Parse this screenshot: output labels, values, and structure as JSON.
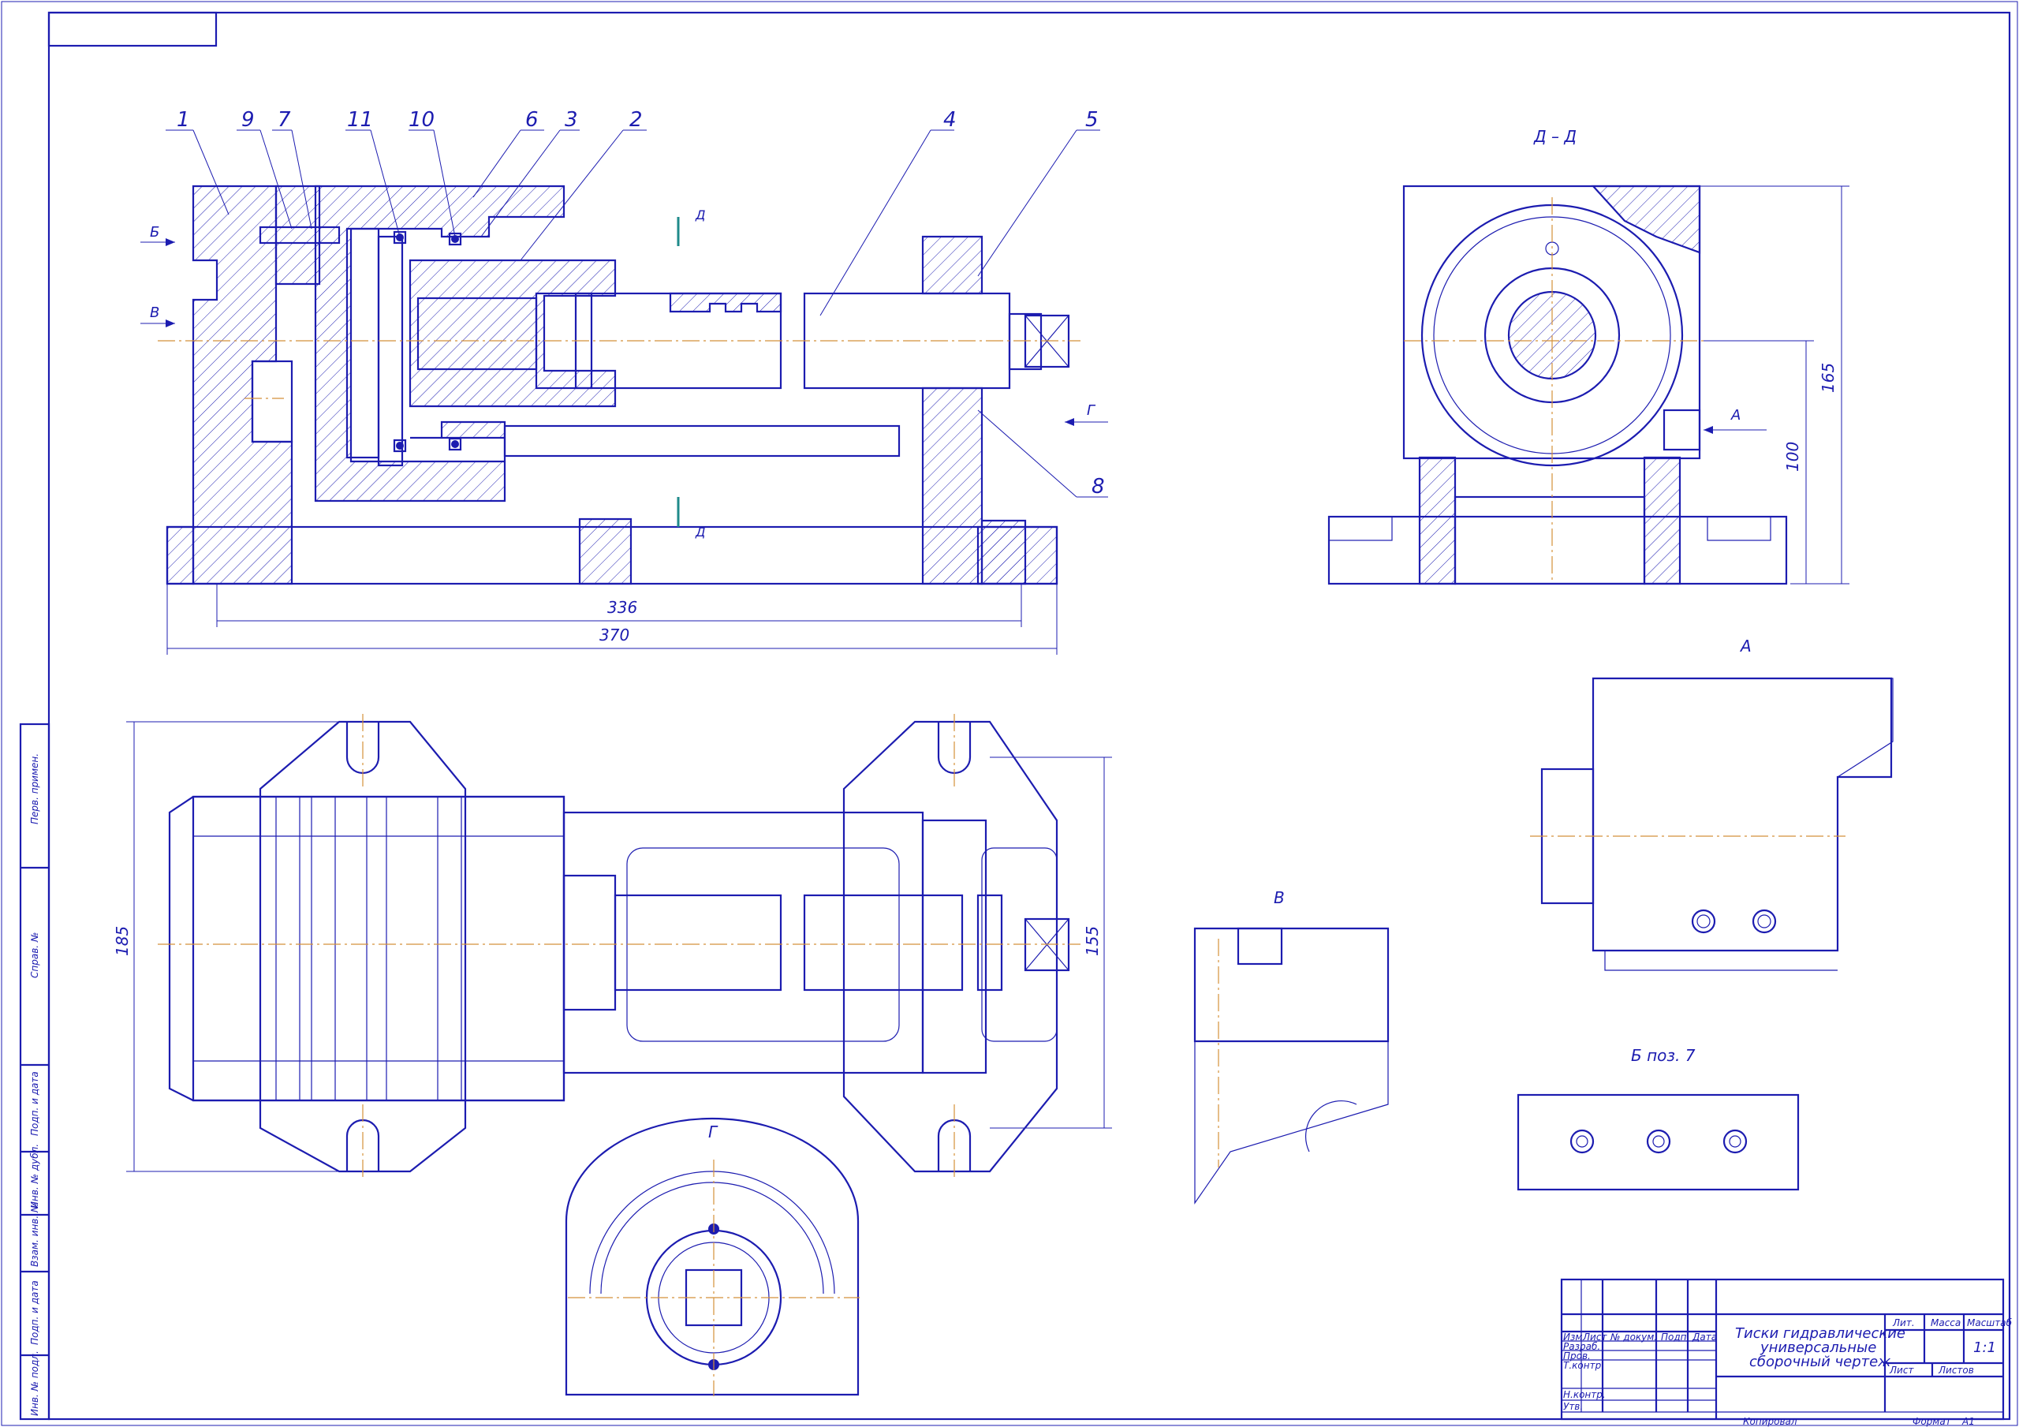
{
  "callouts": [
    "1",
    "9",
    "7",
    "11",
    "10",
    "6",
    "3",
    "2",
    "4",
    "5",
    "8"
  ],
  "view_labels": {
    "section_dd": "Д – Д",
    "view_a": "А",
    "view_b_detail": "Б поз. 7",
    "view_v": "В",
    "view_g": "Г",
    "arrow_b": "Б",
    "arrow_v": "В",
    "arrow_g": "Г",
    "arrow_a": "А",
    "cut_d": "Д"
  },
  "dimensions": {
    "d336": "336",
    "d370": "370",
    "d185": "185",
    "d155": "155",
    "d165": "165",
    "d100": "100"
  },
  "side_stamp": {
    "perv_primen": "Перв. примен.",
    "sprav_no": "Справ. №",
    "podp_data_1": "Подп. и дата",
    "inv_dubl": "Инв. № дубл.",
    "vzam_inv": "Взам. инв. №",
    "podp_data_2": "Подп. и дата",
    "inv_podl": "Инв. № подл."
  },
  "title_block": {
    "title_line1": "Тиски гидравлические",
    "title_line2": "универсальные",
    "title_line3": "сборочный чертеж",
    "col_izm": "Изм",
    "col_list": "Лист",
    "col_doc": "№ докум.",
    "col_podp": "Подп.",
    "col_data": "Дата",
    "row_razrab": "Разраб.",
    "row_prov": "Пров.",
    "row_tkontr": "Т.контр.",
    "row_nkontr": "Н.контр.",
    "row_utv": "Утв.",
    "lit": "Лит.",
    "massa": "Масса",
    "masshtab": "Масштаб",
    "scale_value": "1:1",
    "list": "Лист",
    "listov": "Листов",
    "kopiroval": "Копировал",
    "format": "Формат",
    "format_value": "A1"
  }
}
